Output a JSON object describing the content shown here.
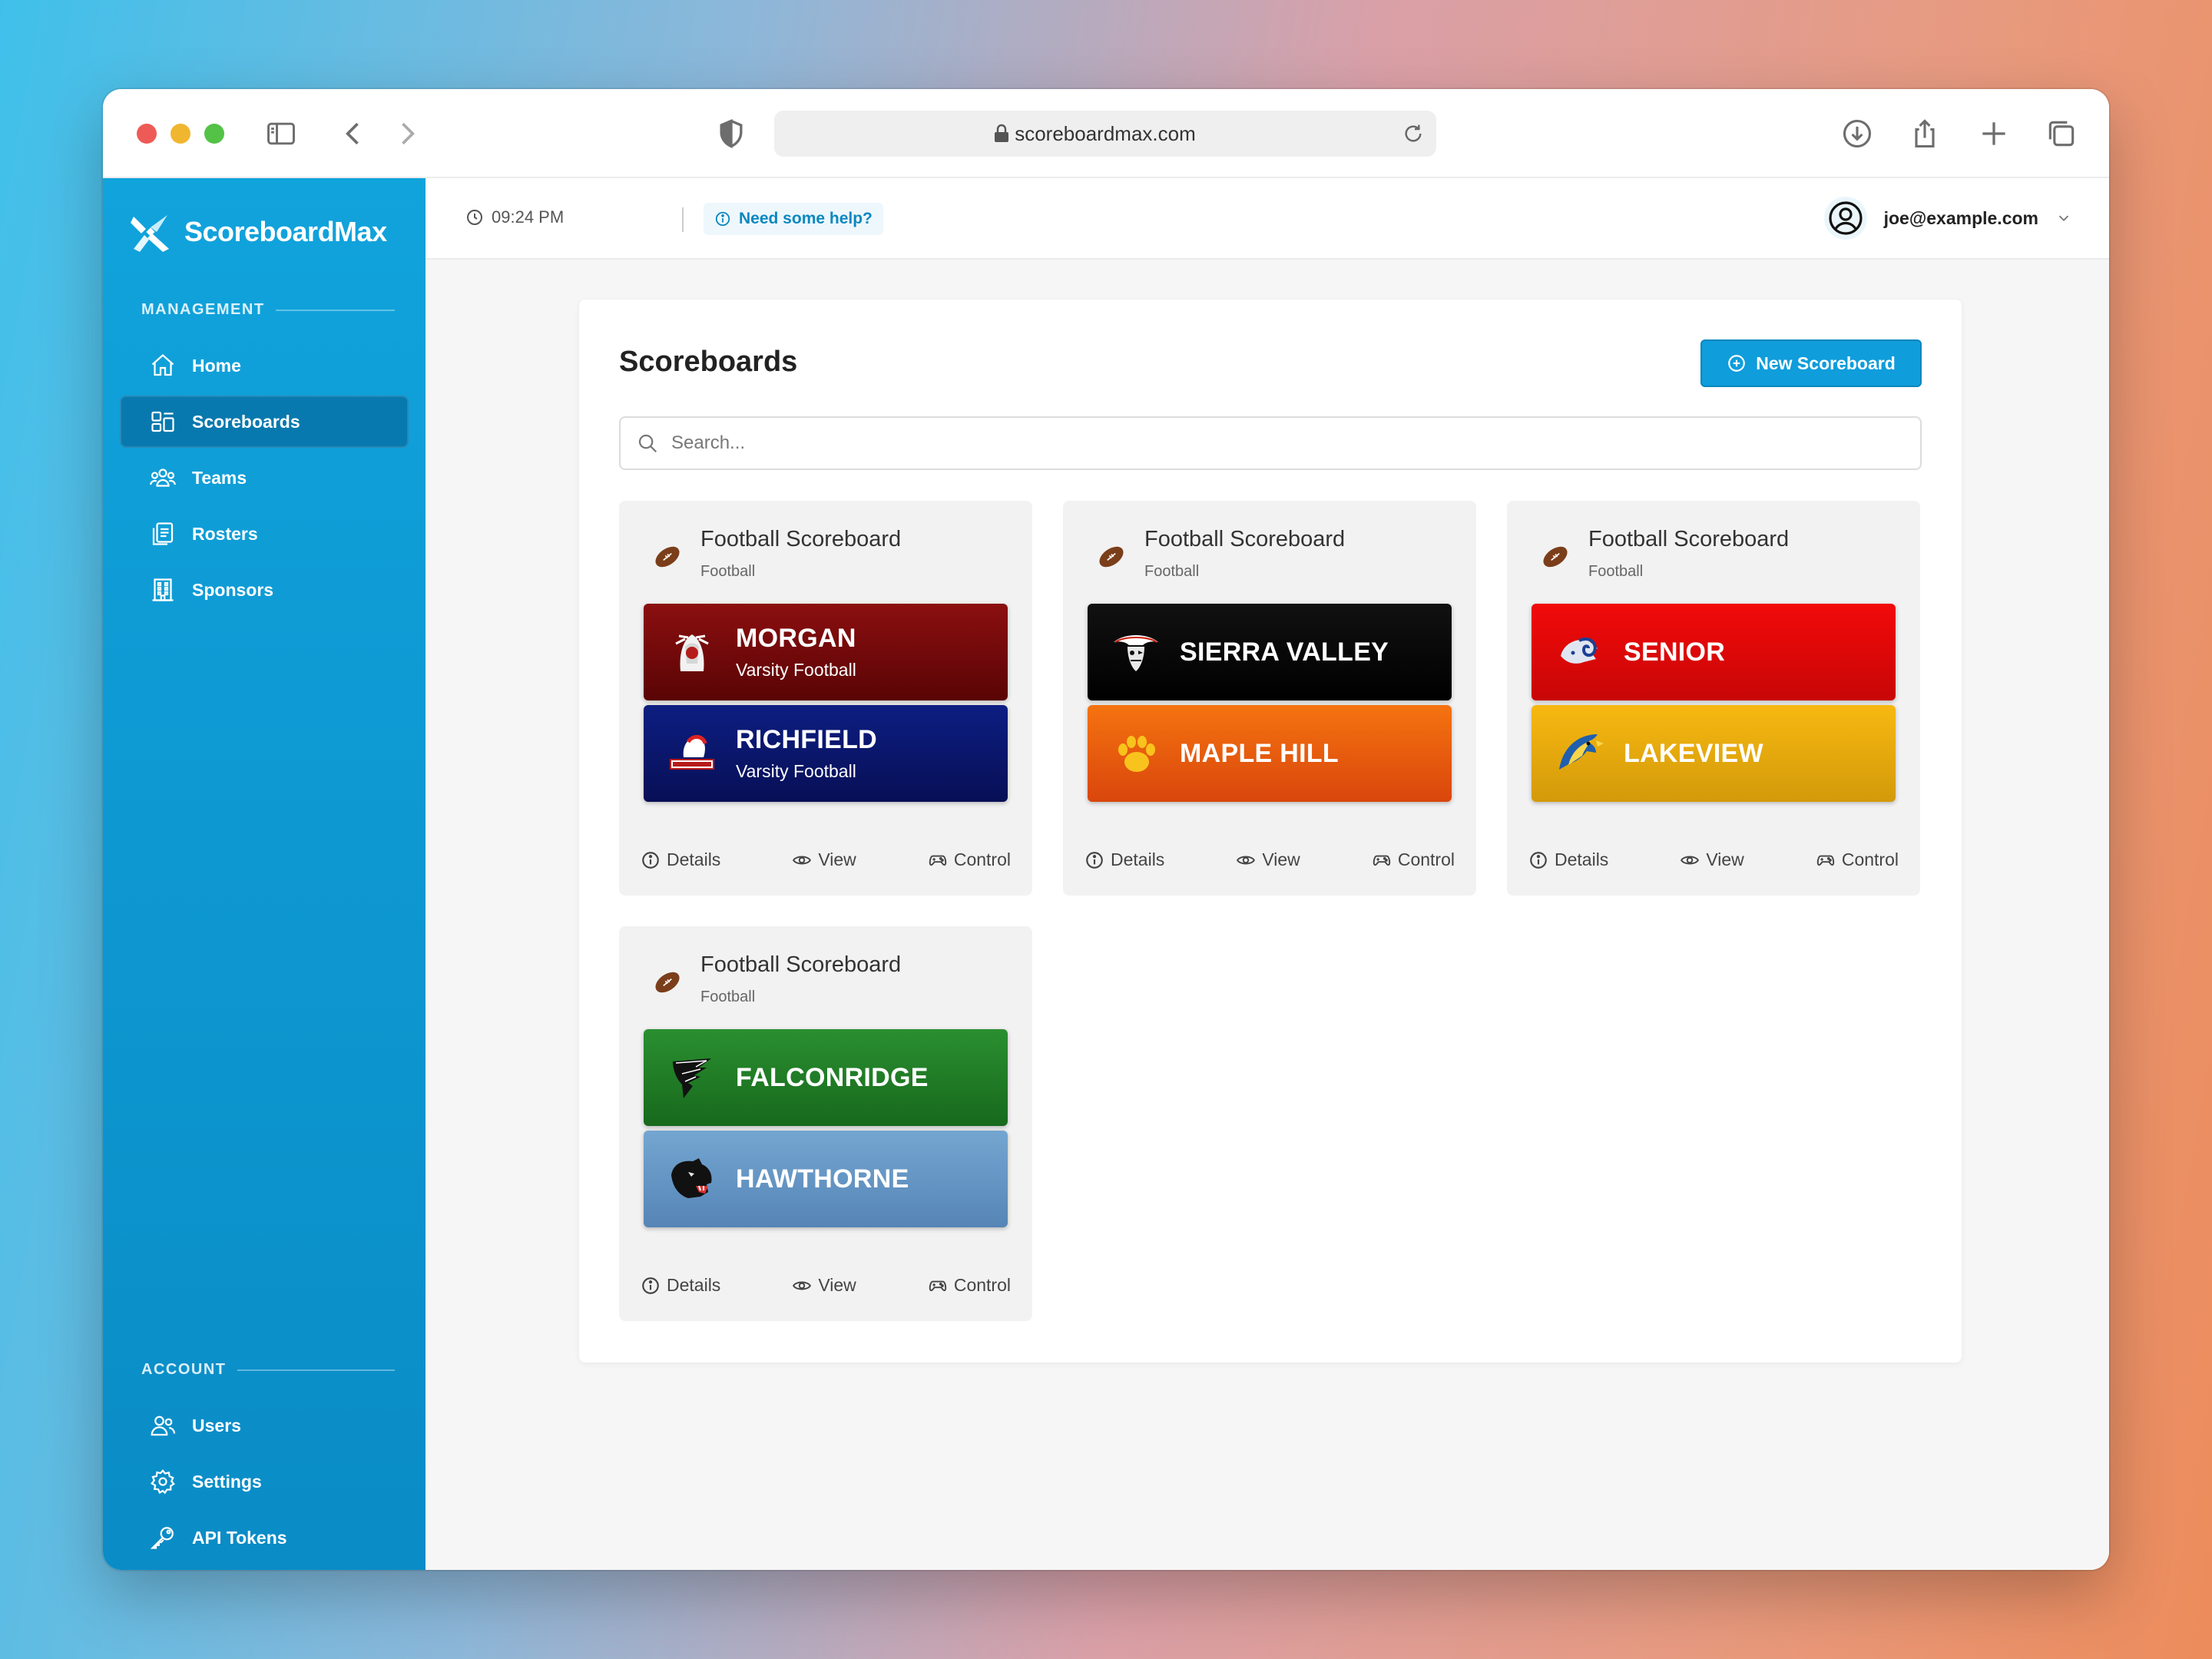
{
  "browser": {
    "url": "scoreboardmax.com"
  },
  "app": {
    "name": "ScoreboardMax",
    "brand_color": "#0f9ddb"
  },
  "sidebar": {
    "management_label": "MANAGEMENT",
    "account_label": "ACCOUNT",
    "management_items": [
      {
        "label": "Home",
        "icon": "home-icon"
      },
      {
        "label": "Scoreboards",
        "icon": "scoreboards-icon",
        "active": true
      },
      {
        "label": "Teams",
        "icon": "teams-icon"
      },
      {
        "label": "Rosters",
        "icon": "rosters-icon"
      },
      {
        "label": "Sponsors",
        "icon": "sponsors-icon"
      }
    ],
    "account_items": [
      {
        "label": "Users",
        "icon": "users-icon"
      },
      {
        "label": "Settings",
        "icon": "gear-icon"
      },
      {
        "label": "API Tokens",
        "icon": "key-icon"
      }
    ]
  },
  "topbar": {
    "time": "09:24 PM",
    "help": "Need some help?",
    "user_email": "joe@example.com"
  },
  "page": {
    "title": "Scoreboards",
    "new_button": "New Scoreboard",
    "search_placeholder": "Search..."
  },
  "cards": [
    {
      "title": "Football Scoreboard",
      "sport": "Football",
      "teams": [
        {
          "name": "MORGAN",
          "subtitle": "Varsity Football",
          "color": "#8b0f10"
        },
        {
          "name": "RICHFIELD",
          "subtitle": "Varsity Football",
          "color": "#0d1e82"
        }
      ]
    },
    {
      "title": "Football Scoreboard",
      "sport": "Football",
      "teams": [
        {
          "name": "SIERRA VALLEY",
          "subtitle": "",
          "color": "#080808"
        },
        {
          "name": "MAPLE HILL",
          "subtitle": "",
          "color": "#f06d10"
        }
      ]
    },
    {
      "title": "Football Scoreboard",
      "sport": "Football",
      "teams": [
        {
          "name": "SENIOR",
          "subtitle": "",
          "color": "#ea0a0a"
        },
        {
          "name": "LAKEVIEW",
          "subtitle": "",
          "color": "#eeaa10"
        }
      ]
    },
    {
      "title": "Football Scoreboard",
      "sport": "Football",
      "teams": [
        {
          "name": "FALCONRIDGE",
          "subtitle": "",
          "color": "#23842a"
        },
        {
          "name": "HAWTHORNE",
          "subtitle": "",
          "color": "#6a9bc7"
        }
      ]
    }
  ],
  "card_actions": {
    "details": "Details",
    "view": "View",
    "control": "Control"
  }
}
